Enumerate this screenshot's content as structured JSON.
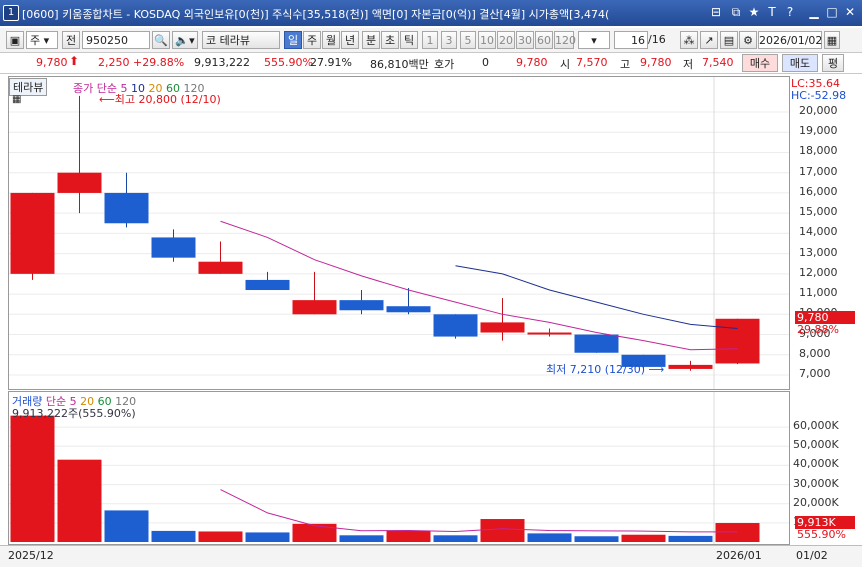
{
  "window": {
    "number": "1",
    "title": "[0600] 키움종합차트 - KOSDAQ 외국인보유[0(천)] 주식수[35,518(천)] 액면[0] 자본금[0(억)] 결산[4월] 시가총액[3,474("
  },
  "toolbar": {
    "market": "주",
    "all_label": "전",
    "code": "950250",
    "stock_name": "테라뷰",
    "periods": [
      "일",
      "주",
      "월",
      "년",
      "분",
      "초",
      "틱"
    ],
    "minute_options": [
      "1",
      "3",
      "5",
      "10",
      "20",
      "30",
      "60",
      "120"
    ],
    "page": "16",
    "page_total": "/16",
    "date": "2026/01/02"
  },
  "quote": {
    "price": "9,780",
    "change": "2,250",
    "change_pct": "+29.88%",
    "volume": "9,913,222",
    "volume_pct": "555.90%",
    "turnover": "27.91%",
    "amount": "86,810백만",
    "hoga_label": "호가",
    "hoga_value": "0",
    "hoga_price": "9,780",
    "open_label": "시",
    "open": "7,570",
    "high_label": "고",
    "high": "9,780",
    "low_label": "저",
    "low": "7,540",
    "buy_label": "매수",
    "sell_label": "매도",
    "eval_label": "평"
  },
  "chart_data": {
    "type": "candlestick",
    "stock_tab": "테라뷰",
    "legend": [
      "종가 단순",
      "5",
      "10",
      "20",
      "60",
      "120"
    ],
    "lc_label": "LC:35.64",
    "hc_label": "HC:-52.98",
    "max_annotation": "최고 20,800 (12/10)",
    "min_annotation": "최저 7,210 (12/30)",
    "price_label": "9,780",
    "price_pct_label": "29.88%",
    "y_ticks": [
      "20,000",
      "19,000",
      "18,000",
      "17,000",
      "16,000",
      "15,000",
      "14,000",
      "13,000",
      "12,000",
      "11,000",
      "10,000",
      "9,000",
      "8,000",
      "7,000"
    ],
    "candles": [
      {
        "o": 12000,
        "h": 16000,
        "l": 11700,
        "c": 16000
      },
      {
        "o": 16000,
        "h": 20800,
        "l": 15000,
        "c": 17000
      },
      {
        "o": 16000,
        "h": 17000,
        "l": 14300,
        "c": 14500
      },
      {
        "o": 13800,
        "h": 14200,
        "l": 12600,
        "c": 12800
      },
      {
        "o": 12000,
        "h": 13600,
        "l": 12000,
        "c": 12600
      },
      {
        "o": 11700,
        "h": 12100,
        "l": 11200,
        "c": 11200
      },
      {
        "o": 10000,
        "h": 12100,
        "l": 10000,
        "c": 10700
      },
      {
        "o": 10700,
        "h": 11200,
        "l": 10000,
        "c": 10200
      },
      {
        "o": 10400,
        "h": 11300,
        "l": 10000,
        "c": 10100
      },
      {
        "o": 10000,
        "h": 10000,
        "l": 8800,
        "c": 8900
      },
      {
        "o": 9100,
        "h": 10800,
        "l": 8700,
        "c": 9600
      },
      {
        "o": 9100,
        "h": 9300,
        "l": 8900,
        "c": 9100
      },
      {
        "o": 9000,
        "h": 9000,
        "l": 8100,
        "c": 8100
      },
      {
        "o": 8000,
        "h": 8000,
        "l": 7210,
        "c": 7400
      },
      {
        "o": 7300,
        "h": 7700,
        "l": 7210,
        "c": 7500
      },
      {
        "o": 7570,
        "h": 9780,
        "l": 7540,
        "c": 9780
      }
    ],
    "ma5": [
      null,
      null,
      null,
      null,
      14600,
      13800,
      12700,
      11900,
      11200,
      10600,
      10000,
      9600,
      9100,
      8700,
      8250,
      8300
    ],
    "ma10": [
      null,
      null,
      null,
      null,
      null,
      null,
      null,
      null,
      null,
      12400,
      12000,
      11200,
      10600,
      10000,
      9500,
      9300
    ],
    "volume_legend": [
      "거래량",
      "단순",
      "5",
      "20",
      "60",
      "120"
    ],
    "volume_value_label": "9,913,222주(555.90%)",
    "volume_ticks": [
      "60,000K",
      "50,000K",
      "40,000K",
      "30,000K",
      "20,000K",
      "10,000K"
    ],
    "volumes": [
      66000,
      43000,
      16500,
      5800,
      5500,
      5000,
      9500,
      3500,
      6000,
      3500,
      12000,
      4500,
      3000,
      3800,
      3200,
      9913
    ],
    "volume_up": [
      true,
      true,
      false,
      false,
      true,
      false,
      true,
      false,
      true,
      false,
      true,
      false,
      false,
      true,
      false,
      true
    ],
    "vol_ma5": [
      null,
      null,
      null,
      null,
      27400,
      15200,
      8500,
      5900,
      6000,
      5500,
      6900,
      6000,
      5800,
      5700,
      5300,
      5300
    ],
    "vol_price_label": "9,913K",
    "vol_pct_label": "555.90%"
  },
  "bottom": {
    "left_date": "2025/12",
    "mid_date": "2026/01",
    "right_date": "01/02"
  }
}
